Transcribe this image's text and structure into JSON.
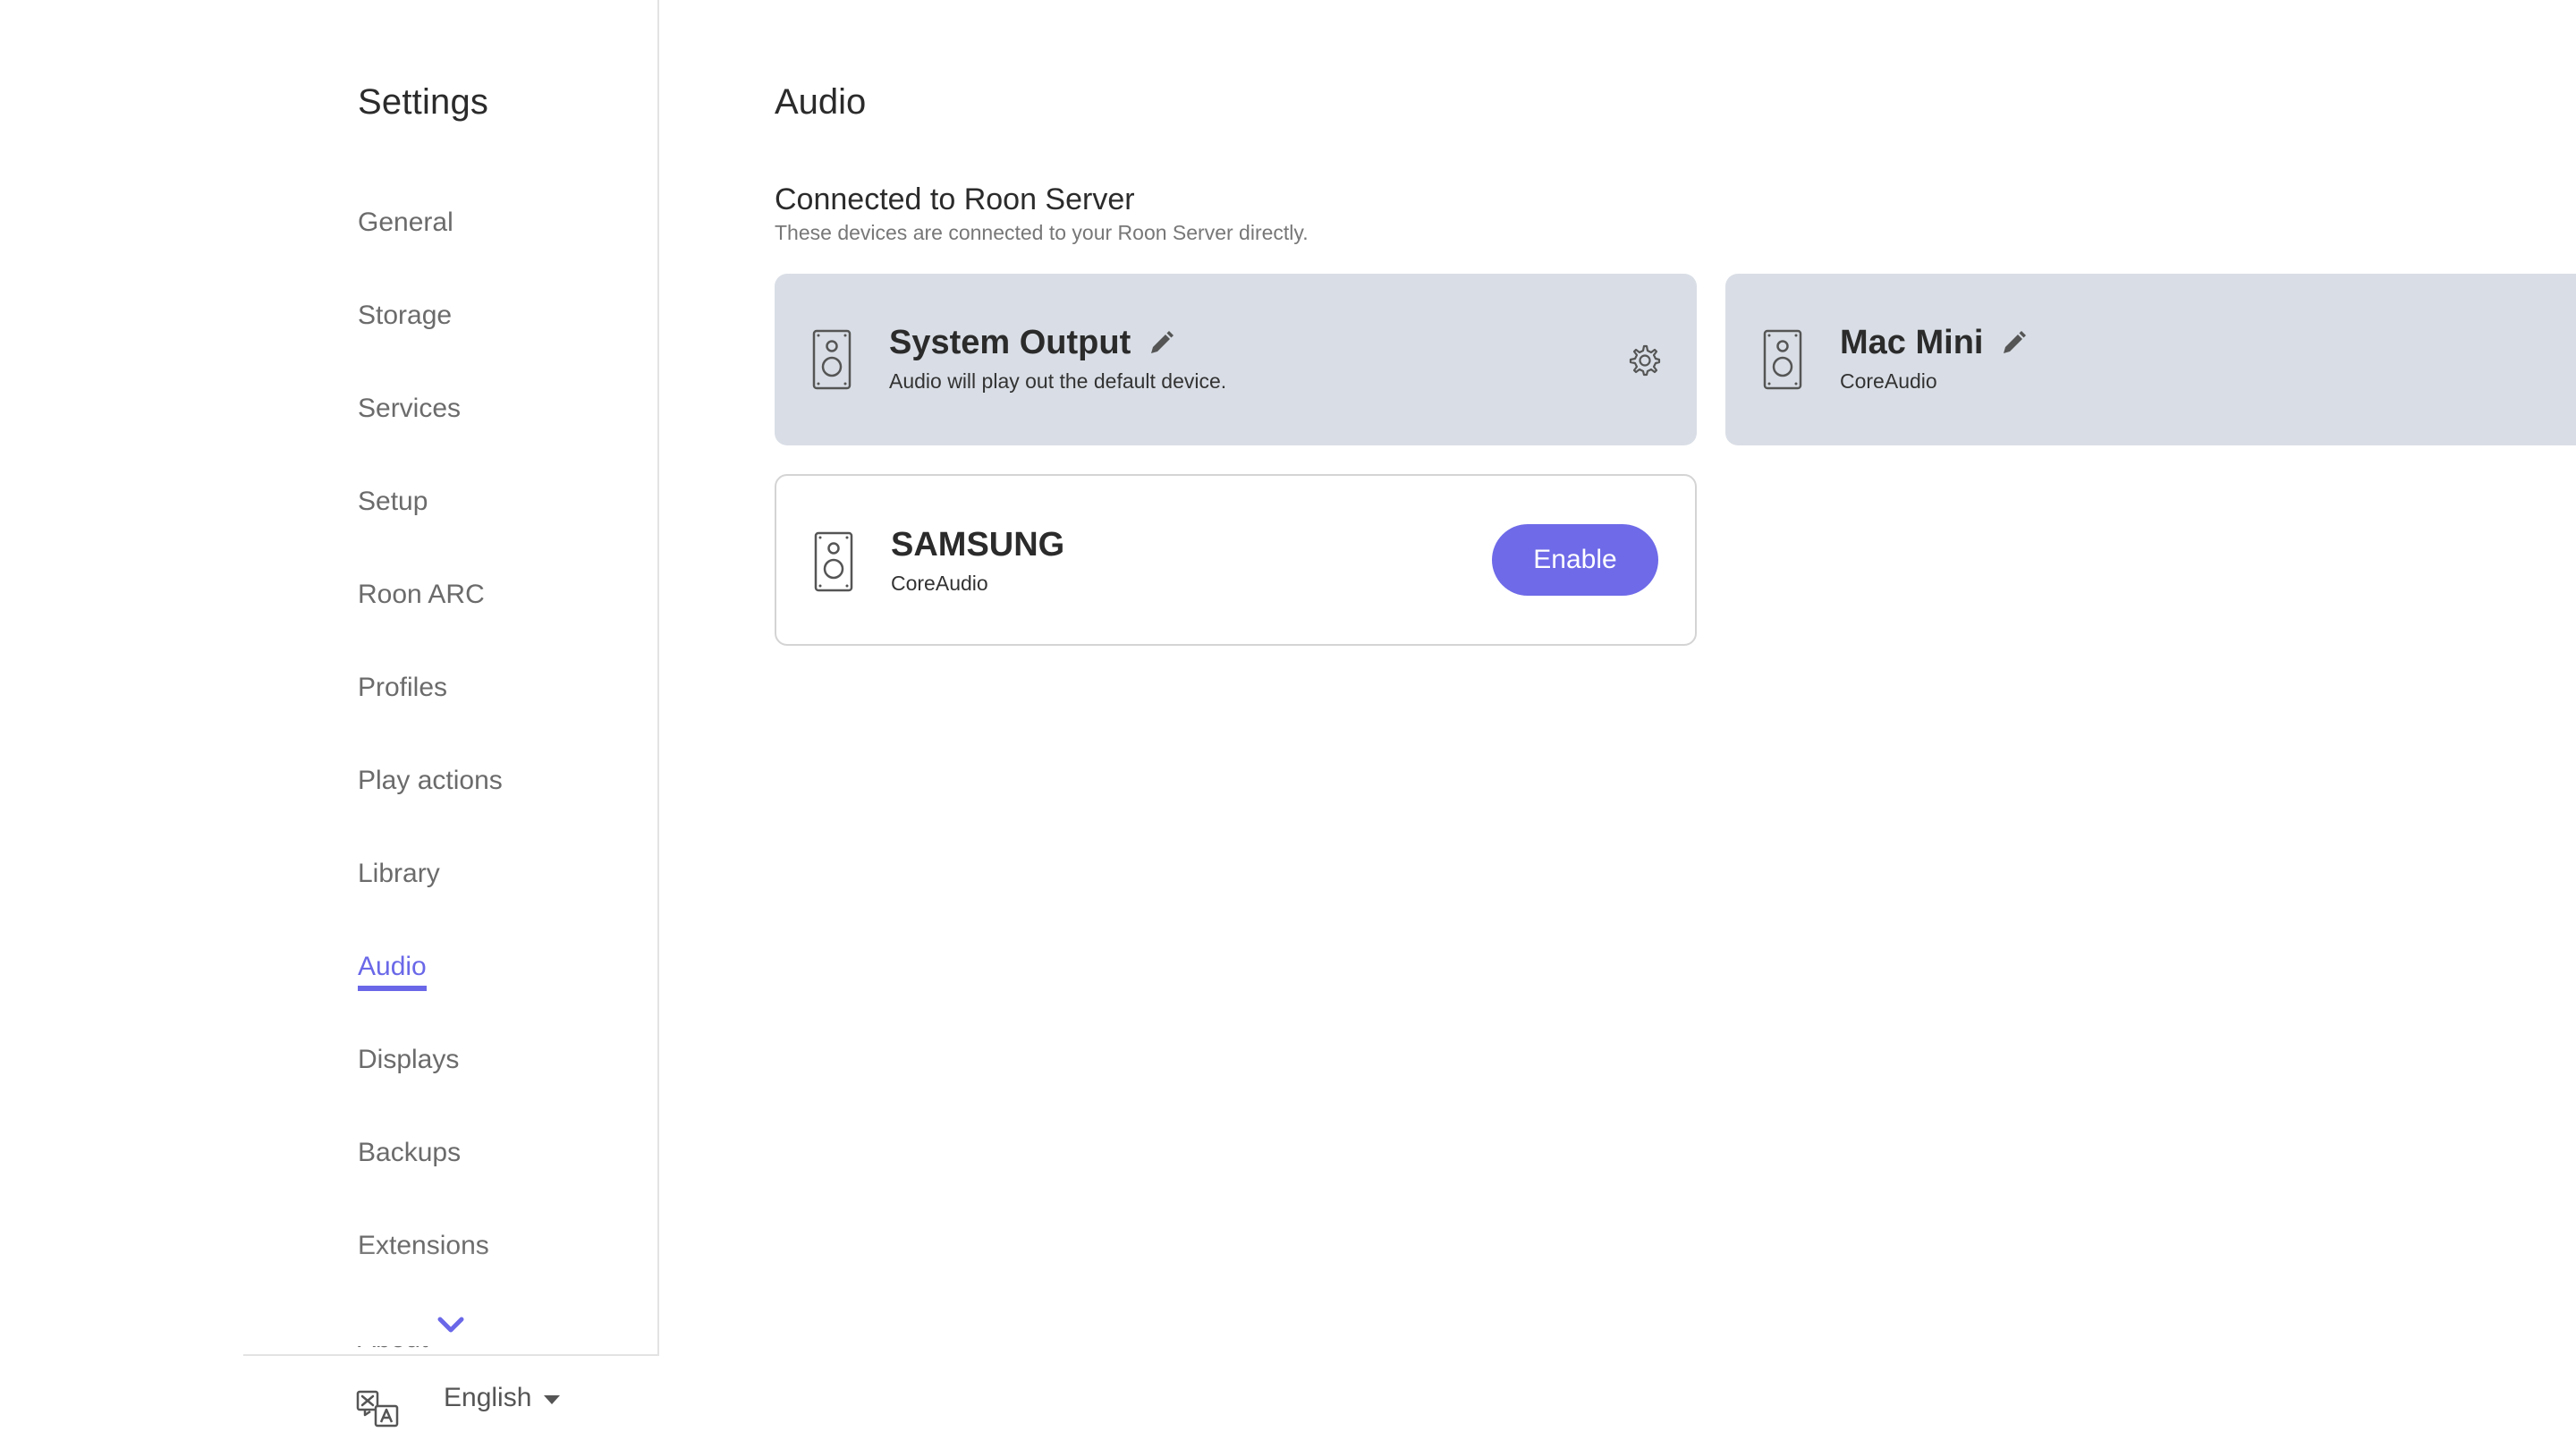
{
  "sidebar": {
    "title": "Settings",
    "items": [
      {
        "label": "General"
      },
      {
        "label": "Storage"
      },
      {
        "label": "Services"
      },
      {
        "label": "Setup"
      },
      {
        "label": "Roon ARC"
      },
      {
        "label": "Profiles"
      },
      {
        "label": "Play actions"
      },
      {
        "label": "Library"
      },
      {
        "label": "Audio"
      },
      {
        "label": "Displays"
      },
      {
        "label": "Backups"
      },
      {
        "label": "Extensions"
      },
      {
        "label": "About"
      }
    ],
    "active_item": "Audio",
    "language": "English",
    "icons": {
      "language": "translate-icon",
      "scroll_more": "chevron-down-icon"
    }
  },
  "main": {
    "title": "Audio",
    "section": {
      "title": "Connected to Roon Server",
      "subtitle": "These devices are connected to your Roon Server directly."
    },
    "devices": [
      {
        "name": "System Output",
        "description": "Audio will play out the default device.",
        "state": "enabled"
      },
      {
        "name": "Mac Mini",
        "description": "CoreAudio",
        "state": "enabled"
      },
      {
        "name": "SAMSUNG",
        "description": "CoreAudio",
        "state": "disabled",
        "action_label": "Enable"
      }
    ]
  },
  "colors": {
    "accent": "#6a68e8",
    "enabled_card_bg": "#d9dee6",
    "button_bg": "#6e6ae8",
    "nav_text": "#6b6b6b"
  }
}
